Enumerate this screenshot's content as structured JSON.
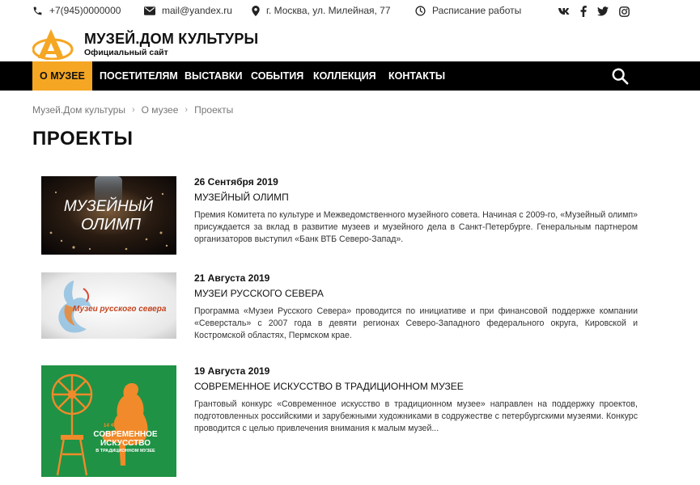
{
  "contacts": {
    "phone": "+7(945)0000000",
    "email": "mail@yandex.ru",
    "address": "г. Москва, ул. Милейная, 77",
    "schedule": "Расписание работы"
  },
  "social_icons": [
    "vk-icon",
    "facebook-icon",
    "twitter-icon",
    "instagram-icon"
  ],
  "site": {
    "title": "МУЗЕЙ.ДОМ КУЛЬТУРЫ",
    "subtitle": "Официальный сайт",
    "accent_color": "#f5a623"
  },
  "nav": {
    "items": [
      "О музее",
      "Посетителям",
      "Выставки",
      "События",
      "Коллекция",
      "Контакты"
    ],
    "active_index": 0
  },
  "breadcrumb": {
    "items": [
      "Музей.Дом культуры",
      "О музее",
      "Проекты"
    ]
  },
  "page": {
    "title": "ПРОЕКТЫ"
  },
  "projects": [
    {
      "date": "26 Сентября 2019",
      "title": "Музейный олимп",
      "description": "Премия Комитета по культуре и Межведомственного музейного совета. Начиная с 2009-го, «Музейный олимп» присуждается за вклад в развитие музеев и музейного дела в Санкт-Петербурге. Генеральным партнером организаторов выступил «Банк ВТБ Северо-Запад».",
      "image_text": [
        "МУЗЕЙНЫЙ",
        "ОЛИМП"
      ]
    },
    {
      "date": "21 Августа 2019",
      "title": "Музеи Русского Севера",
      "description": "Программа «Музеи Русского Севера» проводится по инициативе и при финансовой поддержке компании «Северсталь» с 2007 года в девяти регионах Северо-Западного федерального округа, Кировской и Костромской областях, Пермском крае.",
      "image_text": [
        "Музеи русского севера"
      ]
    },
    {
      "date": "19 Августа 2019",
      "title": "Современное искусство в традиционном музее",
      "description": "Грантовый конкурс «Современное искусство в традиционном музее» направлен на поддержку проектов, подготовленных российскими и зарубежными художниками в содружестве с петербургскими музеями. Конкурс проводится с целью привлечения внимания к малым музей...",
      "image_text": [
        "14 ФЕСТИВАЛЬ",
        "СОВРЕМЕННОЕ",
        "ИСКУССТВО",
        "В ТРАДИЦИОННОМ МУЗЕЕ"
      ]
    }
  ]
}
